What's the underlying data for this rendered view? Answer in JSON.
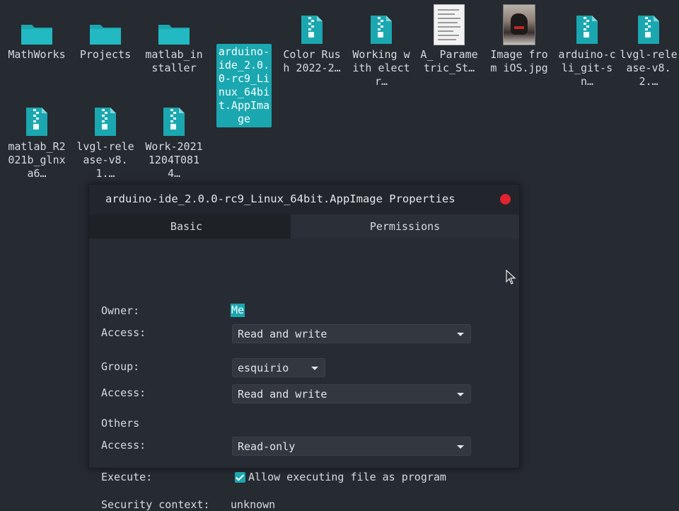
{
  "desktop": {
    "icons": [
      {
        "label": "MathWorks",
        "type": "folder"
      },
      {
        "label": "Projects",
        "type": "folder"
      },
      {
        "label": "matlab_installer",
        "type": "folder"
      },
      {
        "label": "arduino-ide_2.0.0-rc9_Linux_64bit.AppImage",
        "type": "archive",
        "selected": true
      },
      {
        "label": "Color Rush 2022-2…",
        "type": "archive"
      },
      {
        "label": "Working with electr…",
        "type": "archive"
      },
      {
        "label": "A_ Parametric_St…",
        "type": "document"
      },
      {
        "label": "Image from iOS.jpg",
        "type": "image"
      },
      {
        "label": "arduino-cli_git-sn…",
        "type": "archive"
      },
      {
        "label": "lvgl-release-v8.2.…",
        "type": "archive"
      },
      {
        "label": "matlab_R2021b_glnxa6…",
        "type": "archive"
      },
      {
        "label": "lvgl-release-v8.1.…",
        "type": "archive"
      },
      {
        "label": "Work-20211204T0814…",
        "type": "archive"
      }
    ]
  },
  "dialog": {
    "title": "arduino-ide_2.0.0-rc9_Linux_64bit.AppImage Properties",
    "tabs": {
      "basic": "Basic",
      "permissions": "Permissions"
    },
    "owner_label": "Owner:",
    "owner_value": "Me",
    "access_label": "Access:",
    "owner_access": "Read and write",
    "group_label": "Group:",
    "group_value": "esquirio",
    "group_access": "Read and write",
    "others_label": "Others",
    "others_access": "Read-only",
    "execute_label": "Execute:",
    "execute_checkbox_label": "Allow executing file as program",
    "security_label": "Security context:",
    "security_value": "unknown"
  },
  "colors": {
    "accent": "#1ba7b0",
    "close": "#e0232f",
    "background": "#262a31"
  }
}
